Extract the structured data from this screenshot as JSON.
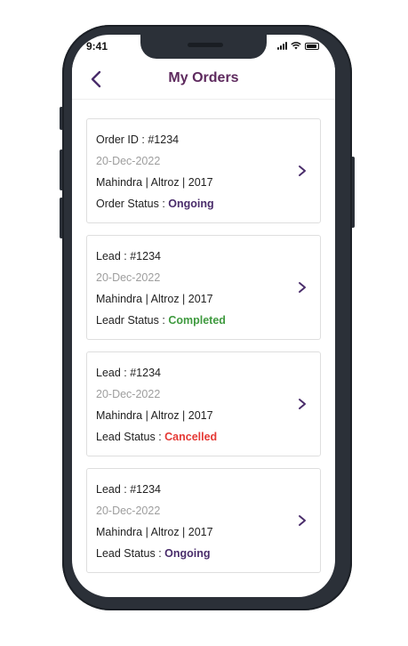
{
  "status_bar": {
    "time": "9:41"
  },
  "header": {
    "title": "My Orders"
  },
  "colors": {
    "accent": "#5e2a5e",
    "ongoing": "#4a2d6b",
    "completed": "#3f9a3f",
    "cancelled": "#e53935",
    "date": "#9e9e9e"
  },
  "orders": [
    {
      "id_label": "Order ID : ",
      "id": "#1234",
      "date": "20-Dec-2022",
      "vehicle": "Mahindra | Altroz | 2017",
      "status_label": "Order Status : ",
      "status": "Ongoing",
      "status_color": "#4a2d6b"
    },
    {
      "id_label": "Lead : ",
      "id": "#1234",
      "date": "20-Dec-2022",
      "vehicle": "Mahindra | Altroz | 2017",
      "status_label": "Leadr Status : ",
      "status": "Completed",
      "status_color": "#3f9a3f"
    },
    {
      "id_label": "Lead : ",
      "id": "#1234",
      "date": "20-Dec-2022",
      "vehicle": "Mahindra | Altroz | 2017",
      "status_label": "Lead Status : ",
      "status": "Cancelled",
      "status_color": "#e53935"
    },
    {
      "id_label": "Lead : ",
      "id": "#1234",
      "date": "20-Dec-2022",
      "vehicle": "Mahindra | Altroz | 2017",
      "status_label": "Lead Status : ",
      "status": "Ongoing",
      "status_color": "#4a2d6b"
    }
  ]
}
